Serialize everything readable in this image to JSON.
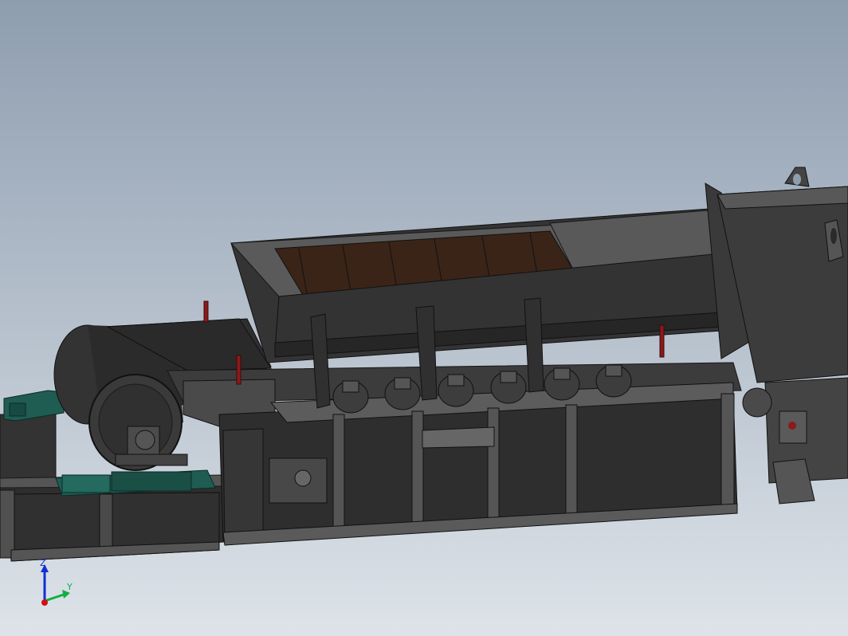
{
  "viewport": {
    "background_top": "#8e9daf",
    "background_bottom": "#dde3e9"
  },
  "model": {
    "steel_color": "#3c3c3c",
    "steel_dark": "#262626",
    "steel_light": "#5a5a5a",
    "liner_color": "#3a2418",
    "motor_color": "#1f5c52",
    "indicator_color": "#8b1a1a"
  },
  "triad": {
    "z_label": "Z",
    "y_label": "Y",
    "x_color": "#d01010",
    "y_color": "#10b040",
    "z_color": "#1030d0"
  }
}
